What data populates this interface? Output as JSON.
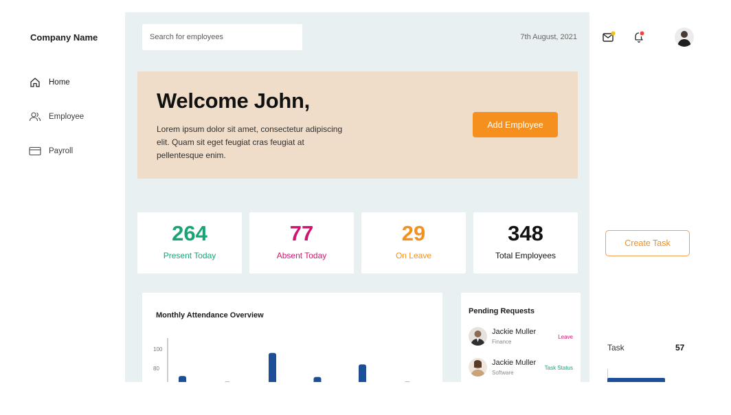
{
  "sidebar": {
    "company": "Company Name",
    "items": [
      {
        "label": "Home",
        "icon": "home-icon"
      },
      {
        "label": "Employee",
        "icon": "people-icon"
      },
      {
        "label": "Payroll",
        "icon": "card-icon"
      }
    ]
  },
  "header": {
    "search_placeholder": "Search for employees",
    "date": "7th August, 2021"
  },
  "welcome": {
    "title": "Welcome John,",
    "body": "Lorem ipsum dolor sit amet, consectetur adipiscing elit. Quam sit eget feugiat cras feugiat at pellentesque enim.",
    "button": "Add Employee"
  },
  "stats": [
    {
      "value": "264",
      "label": "Present Today",
      "color": "#17a673"
    },
    {
      "value": "77",
      "label": "Absent Today",
      "color": "#d1146f"
    },
    {
      "value": "29",
      "label": "On Leave",
      "color": "#f5901f"
    },
    {
      "value": "348",
      "label": "Total Employees",
      "color": "#111111"
    }
  ],
  "attendance": {
    "title": "Monthly Attendance Overview"
  },
  "chart_data": {
    "type": "bar",
    "title": "Monthly Attendance Overview",
    "y_ticks": [
      "100",
      "80"
    ],
    "ylim": [
      0,
      100
    ],
    "values": [
      72,
      66,
      96,
      71,
      84,
      66
    ],
    "color": "#1d4f98",
    "grid": false
  },
  "pending": {
    "title": "Pending Requests",
    "requests": [
      {
        "name": "Jackie Muller",
        "dept": "Finance",
        "status": "Leave",
        "status_color": "#d1146f"
      },
      {
        "name": "Jackie Muller",
        "dept": "Software",
        "status": "Task Status",
        "status_color": "#17a673"
      }
    ]
  },
  "right_panel": {
    "create_task": "Create Task",
    "task_label": "Task",
    "task_value": "57"
  },
  "colors": {
    "accent": "#f5901f",
    "bar": "#1d4f98",
    "main_bg": "#e9f0f1",
    "welcome_bg": "#efddc9"
  }
}
